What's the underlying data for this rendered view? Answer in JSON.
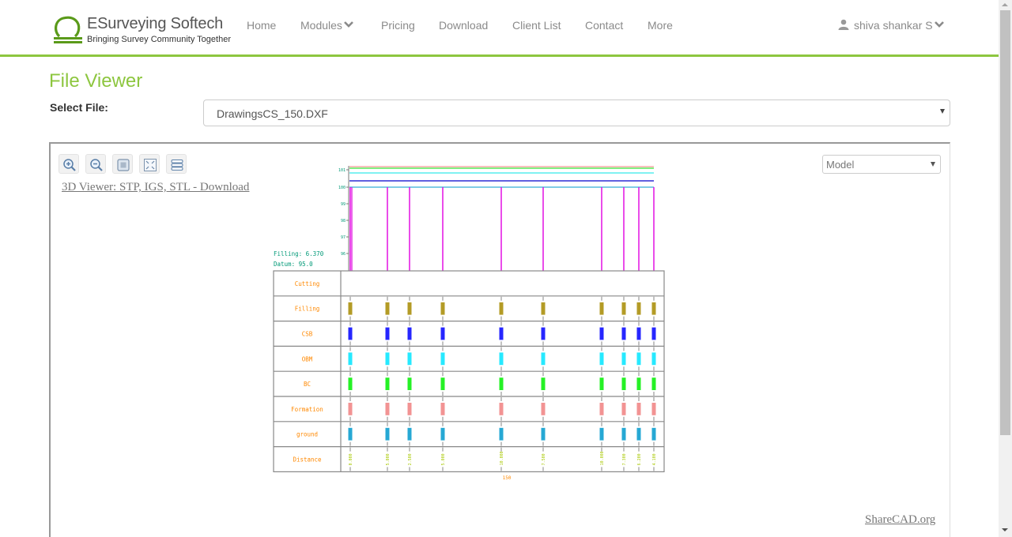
{
  "brand": {
    "title_e": "E",
    "title_rest": "Surveying Softech",
    "subtitle": "Bringing Survey Community Together"
  },
  "nav": {
    "items": [
      "Home",
      "Modules",
      "Pricing",
      "Download",
      "Client List",
      "Contact",
      "More"
    ],
    "user": "shiva shankar S"
  },
  "page": {
    "title": "File Viewer",
    "select_label": "Select File:",
    "selected_file": "DrawingsCS_150.DXF"
  },
  "viewer": {
    "tools": [
      "zoom-in",
      "zoom-out",
      "zoom-extents",
      "fullscreen",
      "layers"
    ],
    "link_3d": "3D Viewer: STP, IGS, STL - Download",
    "layout_select": "Model",
    "footer_link": "ShareCAD.org"
  },
  "drawing": {
    "filling_text": "Filling: 6.370",
    "datum_text": "Datum: 95.0",
    "section_label": "150",
    "y_ticks": [
      "101",
      "100",
      "99",
      "98",
      "97",
      "96"
    ],
    "row_labels": [
      "Cutting",
      "Filling",
      "CSB",
      "OBM",
      "BC",
      "Formation",
      "ground",
      "Distance"
    ],
    "row_colors": {
      "Cutting": "#ff9900",
      "Filling": "#a68a00",
      "CSB": "#0000ff",
      "OBM": "#00e5ff",
      "BC": "#00ee00",
      "Formation": "#f08080",
      "ground": "#0099cc",
      "Distance": "#a8c800",
      "label": "#ff8800"
    },
    "station_count": 10,
    "level_lines": [
      {
        "name": "formation",
        "color": "#ff7f7f"
      },
      {
        "name": "bc",
        "color": "#00dd00"
      },
      {
        "name": "obm",
        "color": "#00e5e5"
      },
      {
        "name": "csb",
        "color": "#0000cc"
      },
      {
        "name": "ground",
        "color": "#0099cc"
      }
    ],
    "distance_values": [
      "0.000",
      "5.000",
      "2.500",
      "5.000",
      "10.000",
      "7.500",
      "10.000",
      "7.300",
      "6.200",
      "4.100"
    ]
  }
}
